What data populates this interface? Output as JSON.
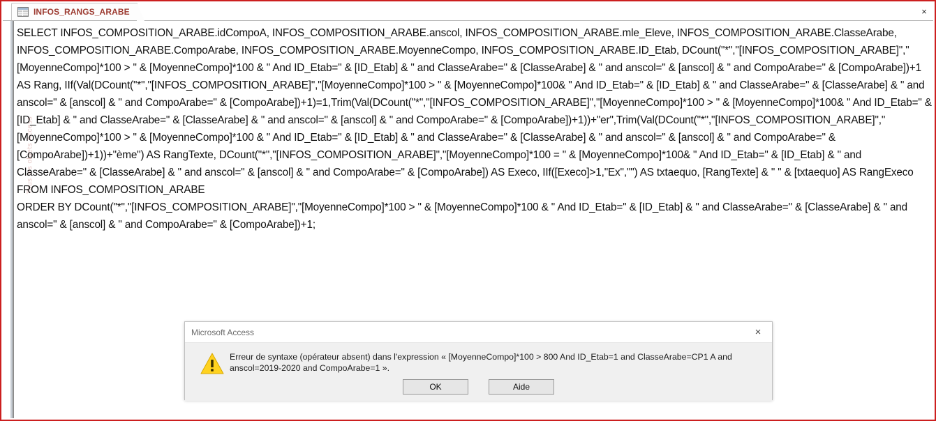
{
  "window": {
    "border_color": "#cc1f1f",
    "close_label": "×"
  },
  "tab": {
    "icon": "query-table-icon",
    "label": "INFOS_RANGS_ARABE",
    "label_color": "#9c3a30"
  },
  "nav_pane": {
    "vertical_label": "Tous les objets Access"
  },
  "sql_editor": {
    "query_text": "SELECT INFOS_COMPOSITION_ARABE.idCompoA, INFOS_COMPOSITION_ARABE.anscol, INFOS_COMPOSITION_ARABE.mle_Eleve, INFOS_COMPOSITION_ARABE.ClasseArabe, INFOS_COMPOSITION_ARABE.CompoArabe, INFOS_COMPOSITION_ARABE.MoyenneCompo, INFOS_COMPOSITION_ARABE.ID_Etab, DCount(\"*\",\"[INFOS_COMPOSITION_ARABE]\",\"[MoyenneCompo]*100 > \" & [MoyenneCompo]*100 & \" And ID_Etab=\" & [ID_Etab] & \" and ClasseArabe=\" & [ClasseArabe] & \" and anscol=\" & [anscol] & \" and CompoArabe=\" & [CompoArabe])+1 AS Rang, IIf(Val(DCount(\"*\",\"[INFOS_COMPOSITION_ARABE]\",\"[MoyenneCompo]*100 > \" & [MoyenneCompo]*100& \" And ID_Etab=\" & [ID_Etab] & \" and ClasseArabe=\" & [ClasseArabe] & \" and anscol=\" & [anscol] & \" and CompoArabe=\" & [CompoArabe])+1)=1,Trim(Val(DCount(\"*\",\"[INFOS_COMPOSITION_ARABE]\",\"[MoyenneCompo]*100 > \" & [MoyenneCompo]*100& \" And ID_Etab=\" & [ID_Etab] & \" and ClasseArabe=\" & [ClasseArabe] & \" and anscol=\" & [anscol] & \" and CompoArabe=\" & [CompoArabe])+1))+\"er\",Trim(Val(DCount(\"*\",\"[INFOS_COMPOSITION_ARABE]\",\"[MoyenneCompo]*100 > \" & [MoyenneCompo]*100 & \" And ID_Etab=\" & [ID_Etab] & \" and ClasseArabe=\" & [ClasseArabe] & \" and anscol=\" & [anscol] & \" and CompoArabe=\" & [CompoArabe])+1))+\"ème\") AS RangTexte, DCount(\"*\",\"[INFOS_COMPOSITION_ARABE]\",\"[MoyenneCompo]*100 = \" & [MoyenneCompo]*100& \" And ID_Etab=\" & [ID_Etab] & \" and ClasseArabe=\" & [ClasseArabe] & \" and anscol=\" & [anscol] & \" and CompoArabe=\" & [CompoArabe]) AS Execo, IIf([Execo]>1,\"Ex\",\"\") AS txtaequo, [RangTexte] & \" \" & [txtaequo] AS RangExeco\nFROM INFOS_COMPOSITION_ARABE\nORDER BY DCount(\"*\",\"[INFOS_COMPOSITION_ARABE]\",\"[MoyenneCompo]*100 > \" & [MoyenneCompo]*100 & \" And ID_Etab=\" & [ID_Etab] & \" and ClasseArabe=\" & [ClasseArabe] & \" and anscol=\" & [anscol] & \" and CompoArabe=\" & [CompoArabe])+1;"
  },
  "dialog": {
    "title": "Microsoft Access",
    "close_label": "×",
    "icon": "warning-triangle-icon",
    "message": "Erreur de syntaxe (opérateur absent) dans l'expression « [MoyenneCompo]*100 > 800 And ID_Etab=1 and ClasseArabe=CP1 A and anscol=2019-2020 and CompoArabe=1 ».",
    "buttons": [
      {
        "label": "OK",
        "name": "ok-button"
      },
      {
        "label": "Aide",
        "name": "aide-button"
      }
    ],
    "warning_color": "#ffd21f"
  }
}
